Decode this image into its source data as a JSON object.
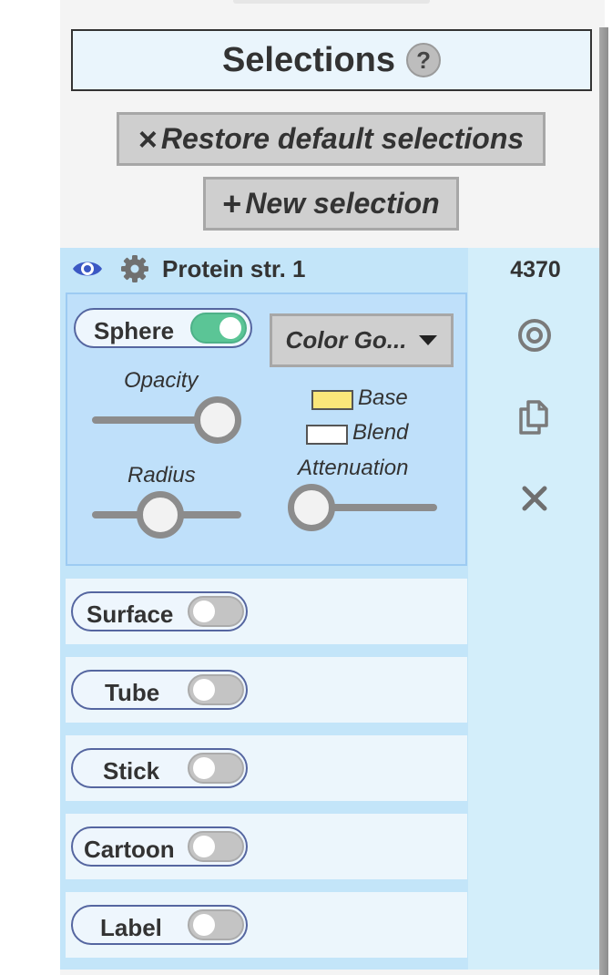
{
  "header": {
    "title": "Selections",
    "help_symbol": "?"
  },
  "buttons": {
    "restore_symbol": "×",
    "restore_label": "Restore default selections",
    "new_symbol": "+",
    "new_label": "New selection"
  },
  "selection": {
    "name": "Protein str. 1",
    "count": "4370",
    "icons": [
      "eye-icon",
      "gear-icon",
      "target-icon",
      "copy-icon",
      "close-icon"
    ]
  },
  "sphere": {
    "label": "Sphere",
    "enabled": true,
    "color_dropdown": "Color Go...",
    "opacity_label": "Opacity",
    "opacity_value": 1.0,
    "radius_label": "Radius",
    "radius_value": 0.5,
    "base_label": "Base",
    "base_color": "#fbe77a",
    "blend_label": "Blend",
    "blend_color": "#ffffff",
    "attenuation_label": "Attenuation",
    "attenuation_value": 0.0
  },
  "representations": [
    {
      "label": "Surface",
      "enabled": false
    },
    {
      "label": "Tube",
      "enabled": false
    },
    {
      "label": "Stick",
      "enabled": false
    },
    {
      "label": "Cartoon",
      "enabled": false
    },
    {
      "label": "Label",
      "enabled": false
    }
  ],
  "colors": {
    "toggle_on": "#5bc596",
    "toggle_off": "#c4c4c4",
    "eye": "#3b58c4",
    "panel_bg": "#c3e5f9"
  }
}
